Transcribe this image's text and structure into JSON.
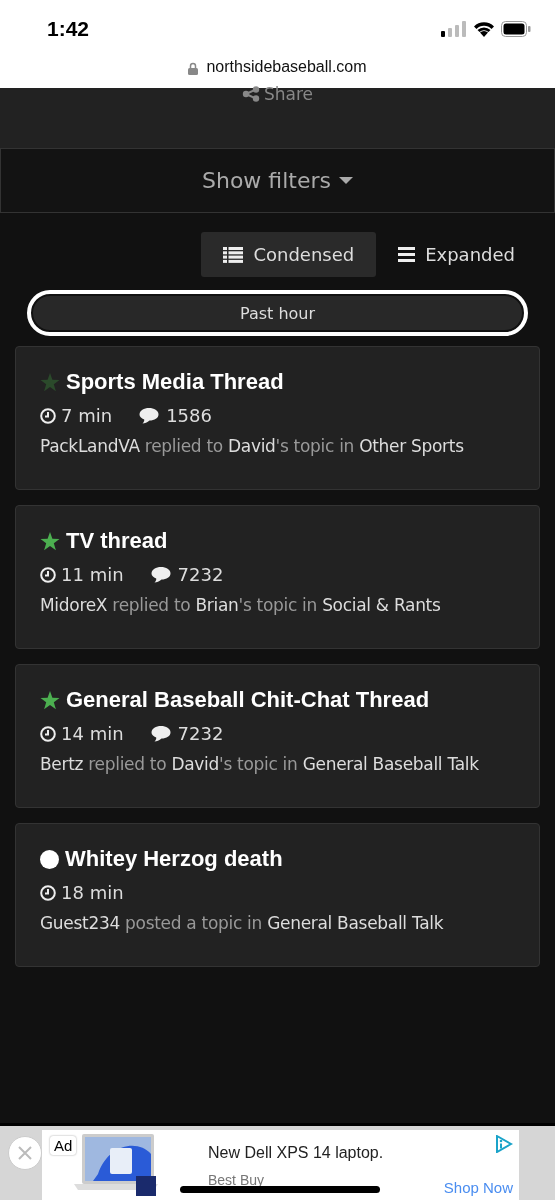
{
  "status_bar": {
    "time": "1:42"
  },
  "url_bar": {
    "domain": "northsidebaseball.com"
  },
  "share": {
    "label": "Share"
  },
  "filters": {
    "label": "Show filters"
  },
  "view_toggle": [
    {
      "label": "Condensed",
      "kind": "list",
      "selected": true
    },
    {
      "label": "Expanded",
      "kind": "bars",
      "selected": false
    }
  ],
  "time_filter": {
    "label": "Past hour"
  },
  "topics": [
    {
      "title": "Sports Media Thread",
      "kind": "star",
      "color": "#2b4a2b",
      "time": "7 min",
      "replies": "1586",
      "byline": [
        {
          "text": "PackLandVA",
          "emphasis": true
        },
        {
          "text": " replied to ",
          "emphasis": false
        },
        {
          "text": "David",
          "emphasis": true
        },
        {
          "text": "'s topic in ",
          "emphasis": false
        },
        {
          "text": "Other Sports",
          "emphasis": true
        }
      ]
    },
    {
      "title": "TV thread",
      "kind": "star",
      "color": "#4caf50",
      "time": "11 min",
      "replies": "7232",
      "byline": [
        {
          "text": "MidoreX",
          "emphasis": true
        },
        {
          "text": " replied to ",
          "emphasis": false
        },
        {
          "text": "Brian",
          "emphasis": true
        },
        {
          "text": "'s topic in ",
          "emphasis": false
        },
        {
          "text": "Social & Rants",
          "emphasis": true
        }
      ]
    },
    {
      "title": "General Baseball Chit-Chat Thread",
      "kind": "star",
      "color": "#4caf50",
      "time": "14 min",
      "replies": "7232",
      "byline": [
        {
          "text": "Bertz",
          "emphasis": true
        },
        {
          "text": " replied to ",
          "emphasis": false
        },
        {
          "text": "David",
          "emphasis": true
        },
        {
          "text": "'s topic in ",
          "emphasis": false
        },
        {
          "text": "General Baseball Talk",
          "emphasis": true
        }
      ]
    },
    {
      "title": "Whitey Herzog death",
      "kind": "dot",
      "color": "#ffffff",
      "time": "18 min",
      "byline": [
        {
          "text": "Guest234",
          "emphasis": true
        },
        {
          "text": " posted a topic in ",
          "emphasis": false
        },
        {
          "text": "General Baseball Talk",
          "emphasis": true
        }
      ]
    }
  ],
  "ad": {
    "badge": "Ad",
    "headline": "New Dell XPS 14 laptop.",
    "advertiser": "Best Buy",
    "cta": "Shop Now"
  }
}
